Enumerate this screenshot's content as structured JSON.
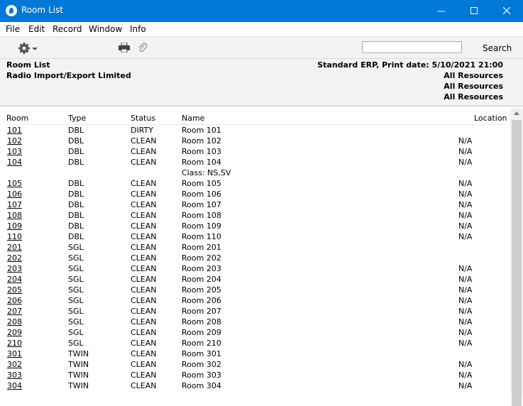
{
  "window": {
    "title": "Room List"
  },
  "menu": [
    "File",
    "Edit",
    "Record",
    "Window",
    "Info"
  ],
  "toolbar": {
    "search_value": "",
    "search_label": "Search"
  },
  "report": {
    "title": "Room List",
    "company": "Radio Import/Export Limited",
    "print_info": "Standard ERP, Print date: 5/10/2021 21:00",
    "filters": [
      "All Resources",
      "All Resources",
      "All Resources"
    ]
  },
  "columns": {
    "room": "Room",
    "type": "Type",
    "status": "Status",
    "name": "Name",
    "location": "Location"
  },
  "rows": [
    {
      "room": "101",
      "type": "DBL",
      "status": "DIRTY",
      "name": "Room 101",
      "location": ""
    },
    {
      "room": "102",
      "type": "DBL",
      "status": "CLEAN",
      "name": "Room 102",
      "location": "N/A"
    },
    {
      "room": "103",
      "type": "DBL",
      "status": "CLEAN",
      "name": "Room 103",
      "location": "N/A"
    },
    {
      "room": "104",
      "type": "DBL",
      "status": "CLEAN",
      "name": "Room 104",
      "location": "N/A"
    },
    {
      "room": "",
      "type": "",
      "status": "",
      "name": "Class: NS,SV",
      "location": ""
    },
    {
      "room": "105",
      "type": "DBL",
      "status": "CLEAN",
      "name": "Room 105",
      "location": "N/A"
    },
    {
      "room": "106",
      "type": "DBL",
      "status": "CLEAN",
      "name": "Room 106",
      "location": "N/A"
    },
    {
      "room": "107",
      "type": "DBL",
      "status": "CLEAN",
      "name": "Room 107",
      "location": "N/A"
    },
    {
      "room": "108",
      "type": "DBL",
      "status": "CLEAN",
      "name": "Room 108",
      "location": "N/A"
    },
    {
      "room": "109",
      "type": "DBL",
      "status": "CLEAN",
      "name": "Room 109",
      "location": "N/A"
    },
    {
      "room": "110",
      "type": "DBL",
      "status": "CLEAN",
      "name": "Room 110",
      "location": "N/A"
    },
    {
      "room": "201",
      "type": "SGL",
      "status": "CLEAN",
      "name": "Room 201",
      "location": ""
    },
    {
      "room": "202",
      "type": "SGL",
      "status": "CLEAN",
      "name": "Room 202",
      "location": ""
    },
    {
      "room": "203",
      "type": "SGL",
      "status": "CLEAN",
      "name": "Room 203",
      "location": "N/A"
    },
    {
      "room": "204",
      "type": "SGL",
      "status": "CLEAN",
      "name": "Room 204",
      "location": "N/A"
    },
    {
      "room": "205",
      "type": "SGL",
      "status": "CLEAN",
      "name": "Room 205",
      "location": "N/A"
    },
    {
      "room": "206",
      "type": "SGL",
      "status": "CLEAN",
      "name": "Room 206",
      "location": "N/A"
    },
    {
      "room": "207",
      "type": "SGL",
      "status": "CLEAN",
      "name": "Room 207",
      "location": "N/A"
    },
    {
      "room": "208",
      "type": "SGL",
      "status": "CLEAN",
      "name": "Room 208",
      "location": "N/A"
    },
    {
      "room": "209",
      "type": "SGL",
      "status": "CLEAN",
      "name": "Room 209",
      "location": "N/A"
    },
    {
      "room": "210",
      "type": "SGL",
      "status": "CLEAN",
      "name": "Room 210",
      "location": "N/A"
    },
    {
      "room": "301",
      "type": "TWIN",
      "status": "CLEAN",
      "name": "Room 301",
      "location": ""
    },
    {
      "room": "302",
      "type": "TWIN",
      "status": "CLEAN",
      "name": "Room 302",
      "location": "N/A"
    },
    {
      "room": "303",
      "type": "TWIN",
      "status": "CLEAN",
      "name": "Room 303",
      "location": "N/A"
    },
    {
      "room": "304",
      "type": "TWIN",
      "status": "CLEAN",
      "name": "Room 304",
      "location": "N/A"
    }
  ]
}
